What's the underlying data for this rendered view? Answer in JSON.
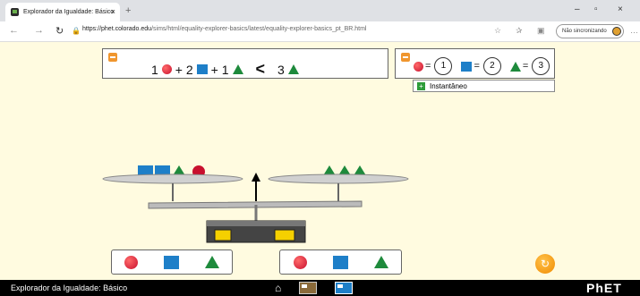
{
  "browser": {
    "tab_title": "Explorador da Igualdade: Básico",
    "tab_close": "×",
    "new_tab": "+",
    "url_host": "https://phet.colorado.edu",
    "url_path": "/sims/html/equality-explorer-basics/latest/equality-explorer-basics_pt_BR.html",
    "sync_label": "Não sincronizando",
    "minimize": "–",
    "maximize": "▫",
    "close": "×"
  },
  "equation": {
    "left_coef1": "1",
    "left_coef2": "+ 2",
    "left_coef3": "+ 1",
    "relation": "<",
    "right_coef": "3"
  },
  "values": {
    "circle": "1",
    "square": "2",
    "triangle": "3",
    "equals": "="
  },
  "snapshot_label": "Instantâneo",
  "navbar": {
    "title": "Explorador da Igualdade: Básico",
    "brand": "PhET"
  },
  "colors": {
    "circle": "#c8102e",
    "square": "#1e7fc8",
    "triangle": "#1e8a3c",
    "background": "#fffbe0",
    "reset": "#f08a00"
  },
  "icons": [
    "back-icon",
    "forward-icon",
    "refresh-icon",
    "lock-icon",
    "star-icon",
    "favorites-icon",
    "collections-icon",
    "home-icon",
    "reset-icon"
  ]
}
